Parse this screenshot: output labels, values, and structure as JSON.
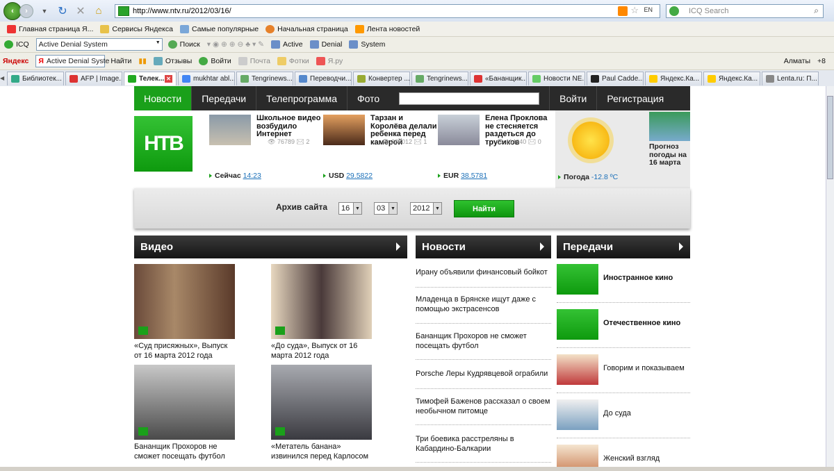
{
  "browser": {
    "url": "http://www.ntv.ru/2012/03/16/",
    "search_placeholder": "ICQ Search",
    "lang": "EN",
    "favorites": [
      "Главная страница Я...",
      "Сервисы Яндекса",
      "Самые популярные",
      "Начальная страница",
      "Лента новостей"
    ],
    "icq_toolbar": {
      "icq": "ICQ",
      "combo": "Active Denial System",
      "search": "Поиск",
      "links": [
        "Active",
        "Denial",
        "System"
      ]
    },
    "yandex_toolbar": {
      "yandex": "Яндекс",
      "combo": "Active Denial Syste",
      "find": "Найти",
      "reviews": "Отзывы",
      "login": "Войти",
      "mail": "Почта",
      "photos": "Фотки",
      "yaru": "Я.ру",
      "city": "Алматы",
      "temp": "+8"
    },
    "tabs": [
      "Библиотек...",
      "AFP | Image...",
      "Телек...",
      "mukhtar abl...",
      "Tengrinews...",
      "Переводчи...",
      "Конвертер ...",
      "Tengrinews...",
      "«Бананщик...",
      "Новости NE...",
      "Paul Cadde...",
      "Яндекс.Ка...",
      "Яндекс.Ка...",
      "Lenta.ru: П..."
    ]
  },
  "site": {
    "nav": [
      "Новости",
      "Передачи",
      "Телепрограмма",
      "Фото"
    ],
    "auth": [
      "Войти",
      "Регистрация"
    ],
    "logo": "НТВ",
    "top_news": [
      {
        "title": "Школьное видео возбудило Интернет",
        "views": "76789",
        "comments": "2"
      },
      {
        "title": "Тарзан и Королёва делали ребенка перед камерой",
        "views": "286012",
        "comments": "1"
      },
      {
        "title": "Елена Проклова не стесняется раздеться до трусиков",
        "views": "114640",
        "comments": "0"
      }
    ],
    "rates": {
      "now_label": "Сейчас",
      "now": "14:23",
      "usd_label": "USD",
      "usd": "29.5822",
      "eur_label": "EUR",
      "eur": "38.5781"
    },
    "weather": {
      "label": "Погода",
      "temp": "-12.8 ºC",
      "forecast": "Прогноз погоды на 16 марта"
    },
    "archive": {
      "label": "Архив сайта",
      "day": "16",
      "month": "03",
      "year": "2012",
      "button": "Найти"
    },
    "video": {
      "title": "Видео",
      "items": [
        "«Суд присяжных», Выпуск от 16 марта 2012 года",
        "«До суда», Выпуск от 16 марта 2012 года",
        "Бананщик Прохоров не сможет посещать футбол",
        "«Метатель банана» извинился перед Карлосом"
      ]
    },
    "news": {
      "title": "Новости",
      "items": [
        "Ирану объявили финансовый бойкот",
        "Младенца в Брянске ищут даже с помощью экстрасенсов",
        "Бананщик Прохоров не сможет посещать футбол",
        "Porsche Леры Кудрявцевой ограбили",
        "Тимофей Баженов рассказал о своем необычном питомце",
        "Три боевика расстреляны в Кабардино-Балкарии"
      ]
    },
    "shows": {
      "title": "Передачи",
      "items": [
        "Иностранное кино",
        "Отечественное кино",
        "Говорим и показываем",
        "До суда",
        "Женский взгляд"
      ]
    }
  }
}
